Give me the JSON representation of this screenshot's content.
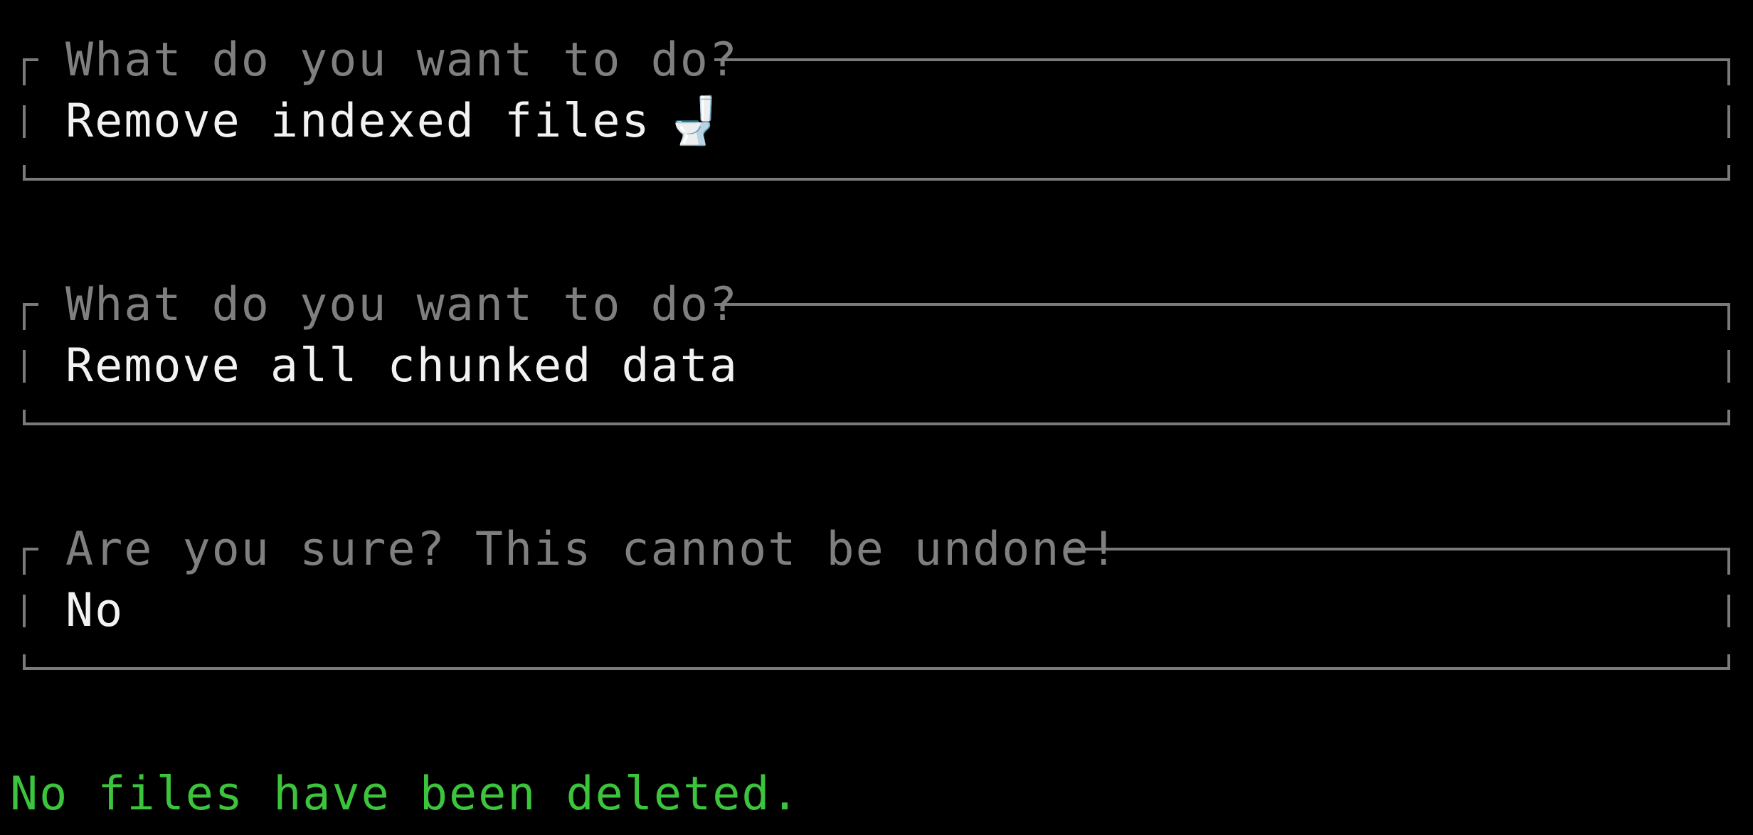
{
  "prompts": [
    {
      "question": "What do you want to do?",
      "answer": "Remove indexed files",
      "answer_icon": "toilet-icon",
      "answer_glyph": "🚽"
    },
    {
      "question": "What do you want to do?",
      "answer": "Remove all chunked data"
    },
    {
      "question": "Are you sure? This cannot be undone!",
      "answer": "No"
    }
  ],
  "result_message": "No files have been deleted.",
  "colors": {
    "background": "#000000",
    "frame": "#7a7a7a",
    "question_text": "#7f7f7f",
    "answer_text": "#f2f2f2",
    "result_text": "#3cc43c"
  }
}
